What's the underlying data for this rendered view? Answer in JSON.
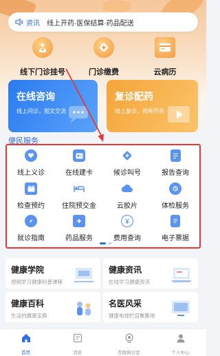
{
  "notice": {
    "tag": "资讯",
    "message": "线上开药·医保结算·药品配送",
    "icon": "speaker-icon"
  },
  "quick_actions": [
    {
      "label": "线下门诊挂号",
      "icon": "doctor-icon"
    },
    {
      "label": "门诊缴费",
      "icon": "plus-badge-icon"
    },
    {
      "label": "云病历",
      "icon": "card-icon"
    }
  ],
  "cards": {
    "consult": {
      "title": "在线咨询",
      "subtitle": "线上问诊，图文交流"
    },
    "refill": {
      "title": "复诊配药",
      "subtitle": "线上复诊，视频开药"
    }
  },
  "services_title": "便民服务",
  "services": [
    {
      "label": "线上义诊",
      "icon": "heart-icon"
    },
    {
      "label": "在线建卡",
      "icon": "id-card-icon"
    },
    {
      "label": "候诊叫号",
      "icon": "diamond-plus-icon"
    },
    {
      "label": "报告查询",
      "icon": "report-icon"
    },
    {
      "label": "检查预约",
      "icon": "calendar-icon"
    },
    {
      "label": "住院预交金",
      "icon": "bed-icon"
    },
    {
      "label": "云胶片",
      "icon": "film-icon"
    },
    {
      "label": "体检服务",
      "icon": "checkup-icon"
    },
    {
      "label": "就诊指南",
      "icon": "compass-icon"
    },
    {
      "label": "药品服务",
      "icon": "medicine-icon"
    },
    {
      "label": "费用查询",
      "icon": "yuan-icon"
    },
    {
      "label": "电子票据",
      "icon": "receipt-icon"
    }
  ],
  "info_cards": [
    {
      "title": "健康学院",
      "subtitle": "视频学习健康科普课程"
    },
    {
      "title": "健康资讯",
      "subtitle": "在线学习健康资讯"
    },
    {
      "title": "健康百科",
      "subtitle": "生活的健康宝典"
    },
    {
      "title": "名医风采",
      "subtitle": "健康电视栏目聚集地"
    }
  ],
  "tabs": [
    {
      "label": "首页",
      "icon": "home-icon",
      "active": true
    },
    {
      "label": "消息",
      "icon": "message-icon",
      "active": false
    },
    {
      "label": "互联网诊室",
      "icon": "camera-icon",
      "active": false
    },
    {
      "label": "个人中心",
      "icon": "user-icon",
      "active": false
    }
  ],
  "colors": {
    "accent": "#2f6fe0",
    "orange": "#f29a3c",
    "highlight": "#e53935"
  }
}
